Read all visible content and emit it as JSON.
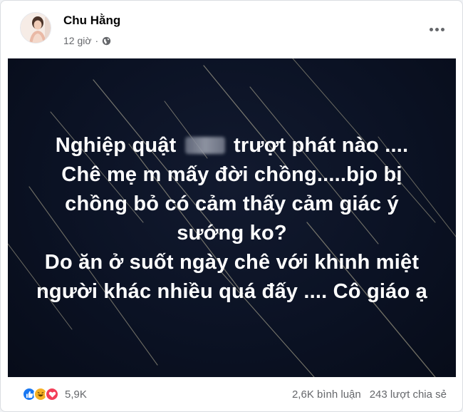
{
  "post": {
    "author": "Chu Hằng",
    "time": "12 giờ",
    "privacy_icon": "globe-icon",
    "more_icon": "more-options-icon"
  },
  "image": {
    "background_color": "#0b1224",
    "text_lines": [
      "trượt phát nào ....",
      "Chê mẹ m mấy đời chồng.....bjo bị",
      "chồng bỏ có cảm thấy cảm giác ý",
      "sướng ko?",
      "Do ăn ở suốt ngày chê với khinh miệt",
      "người khác nhiều quá đấy .... Cô giáo ạ"
    ],
    "line1_prefix": "Nghiệp quật"
  },
  "footer": {
    "reaction_icons": [
      "like-icon",
      "haha-icon",
      "love-icon"
    ],
    "reaction_count": "5,9K",
    "comments": "2,6K bình luận",
    "shares": "243 lượt chia sẻ"
  },
  "colors": {
    "like": "#1877f2",
    "haha": "#f7b125",
    "love": "#f33e58",
    "secondary_text": "#65676b"
  }
}
